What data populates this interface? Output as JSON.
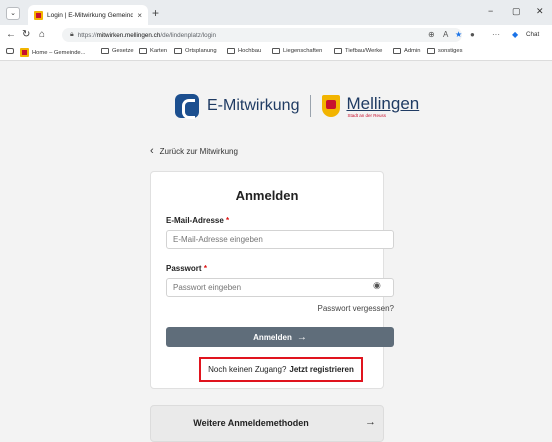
{
  "browser": {
    "tab_title": "Login | E-Mitwirkung Gemeinde M",
    "tab_close": "×",
    "new_tab": "+",
    "url_prefix": "https://",
    "url_host": "mitwirken.mellingen.ch",
    "url_path": "/de/lindenplatz/login",
    "chat_label": "Chat",
    "window_controls": {
      "minimize": "−",
      "maximize": "▢",
      "close": "✕"
    }
  },
  "bookmarks": [
    {
      "label": "Home – Gemeinde...",
      "icon": "town-favicon"
    },
    {
      "label": "Gesetze",
      "icon": "folder-icon"
    },
    {
      "label": "Karten",
      "icon": "folder-icon"
    },
    {
      "label": "Ortsplanung",
      "icon": "folder-icon"
    },
    {
      "label": "Hochbau",
      "icon": "folder-icon"
    },
    {
      "label": "Liegenschaften",
      "icon": "folder-icon"
    },
    {
      "label": "Tiefbau/Werke",
      "icon": "folder-icon"
    },
    {
      "label": "Admin",
      "icon": "folder-icon"
    },
    {
      "label": "sonstiges",
      "icon": "folder-icon"
    }
  ],
  "brand": {
    "app_name": "E-Mitwirkung",
    "town_name": "Mellingen",
    "town_tagline": "Stadt an der Reuss"
  },
  "back_link": "Zurück zur Mitwirkung",
  "login": {
    "title": "Anmelden",
    "email_label": "E-Mail-Adresse",
    "email_placeholder": "E-Mail-Adresse eingeben",
    "password_label": "Passwort",
    "password_placeholder": "Passwort eingeben",
    "required_mark": "*",
    "forgot_label": "Passwort vergessen?",
    "submit_label": "Anmelden",
    "submit_arrow": "→",
    "register_prefix": "Noch keinen Zugang?",
    "register_link": "Jetzt registrieren"
  },
  "more_methods": {
    "label": "Weitere Anmeldemethoden",
    "arrow": "→"
  },
  "colors": {
    "brand_blue": "#1c4f8f",
    "button_gray": "#5f6d7a",
    "highlight_red": "#e0141e",
    "town_yellow": "#f2b400"
  }
}
